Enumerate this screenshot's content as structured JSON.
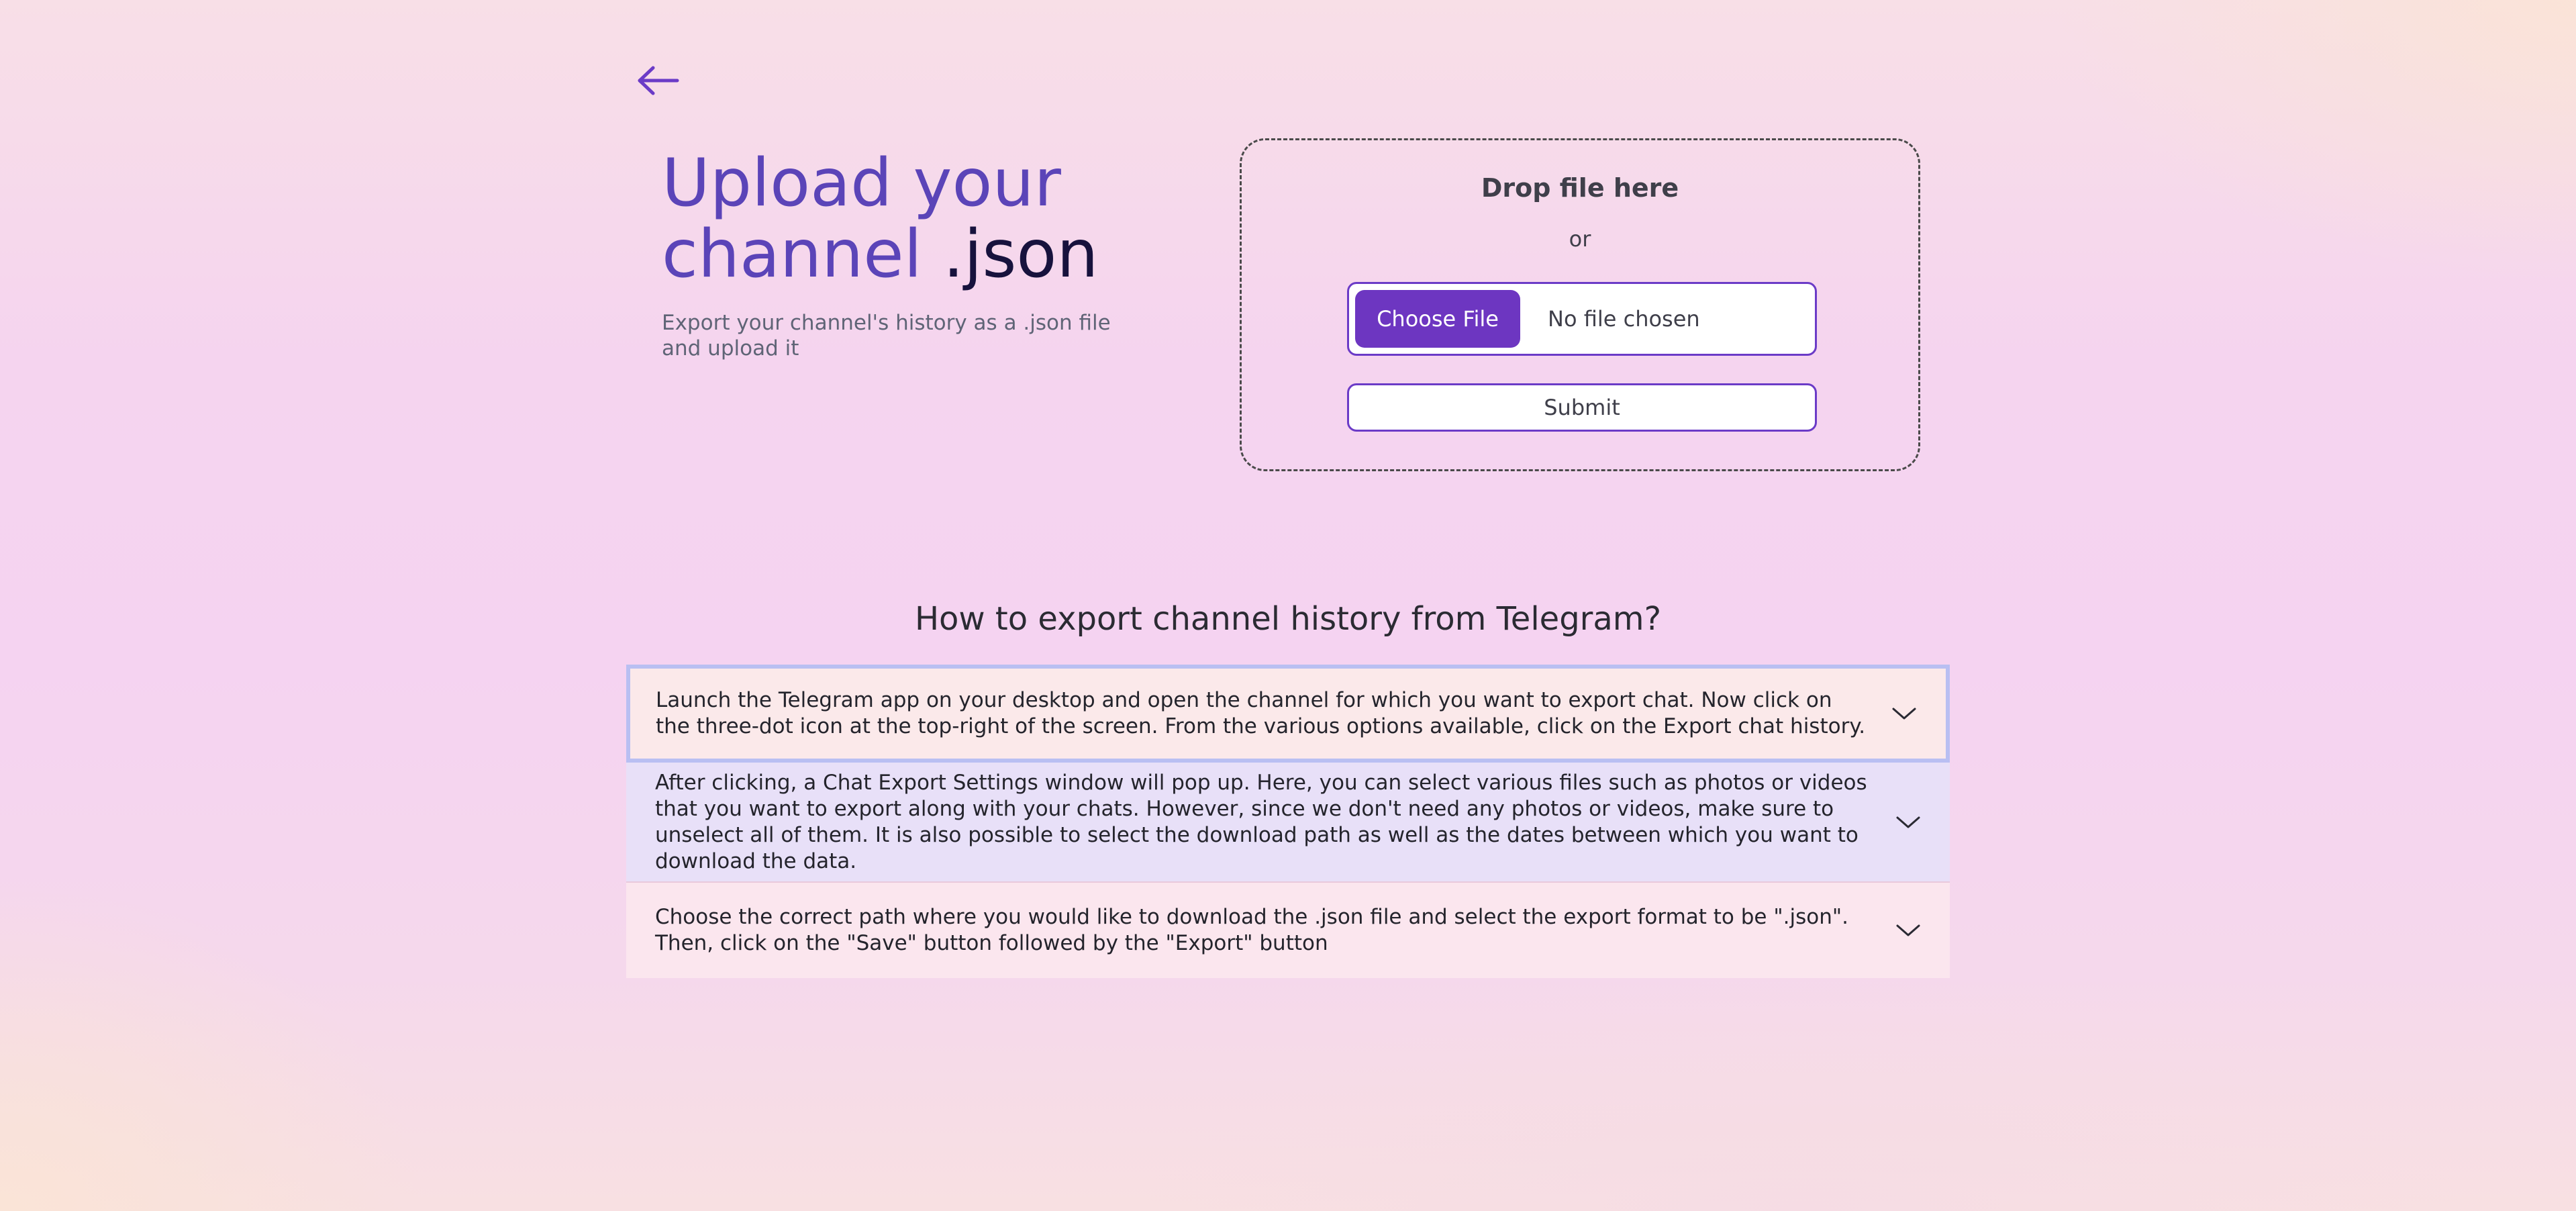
{
  "nav": {
    "back_icon": "arrow-left-icon",
    "accent_color": "#6b3bc7"
  },
  "hero": {
    "title_part1": "Upload your",
    "title_part2": "channel",
    "title_part3": ".json",
    "subtitle": "Export your channel's history as a .json file and upload it",
    "title_accent_color": "#5b44b8",
    "title_dark_color": "#17123d"
  },
  "upload": {
    "drop_label": "Drop file here",
    "or_label": "or",
    "choose_button_label": "Choose File",
    "file_status": "No file chosen",
    "submit_label": "Submit",
    "button_color": "#6d36c1"
  },
  "faq": {
    "heading": "How to export channel history from Telegram?",
    "items": [
      {
        "text": "Launch the Telegram app on your desktop and open the channel for which you want to export chat. Now click on the three-dot icon at the top-right of the screen. From the various options available, click on the Export chat history.",
        "icon": "chevron-down-icon"
      },
      {
        "text": "After clicking, a Chat Export Settings window will pop up. Here, you can select various files such as photos or videos that you want to export along with your chats. However, since we don't need any photos or videos, make sure to unselect all of them. It is also possible to select the download path as well as the dates between which you want to download the data.",
        "icon": "chevron-down-icon"
      },
      {
        "text": "Choose the correct path where you would like to download the .json file and select the export format to be \".json\". Then, click on the \"Save\" button followed by the \"Export\" button",
        "icon": "chevron-down-icon"
      }
    ]
  }
}
